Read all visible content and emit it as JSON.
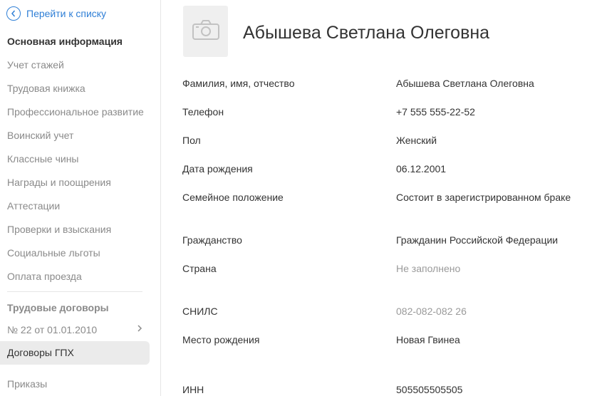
{
  "sidebar": {
    "back_label": "Перейти к списку",
    "items": [
      {
        "label": "Основная информация"
      },
      {
        "label": "Учет стажей"
      },
      {
        "label": "Трудовая книжка"
      },
      {
        "label": "Профессиональное развитие"
      },
      {
        "label": "Воинский учет"
      },
      {
        "label": "Классные чины"
      },
      {
        "label": "Награды и поощрения"
      },
      {
        "label": "Аттестации"
      },
      {
        "label": "Проверки и взыскания"
      },
      {
        "label": "Социальные льготы"
      },
      {
        "label": "Оплата проезда"
      }
    ],
    "contracts_title": "Трудовые договоры",
    "contract_item": "№ 22 от 01.01.2010",
    "gph_label": "Договоры ГПХ",
    "orders_label": "Приказы"
  },
  "profile": {
    "full_name": "Абышева Светлана Олеговна",
    "fields": [
      {
        "label": "Фамилия, имя, отчество",
        "value": "Абышева Светлана Олеговна"
      },
      {
        "label": "Телефон",
        "value": "+7 555 555-22-52"
      },
      {
        "label": "Пол",
        "value": "Женский"
      },
      {
        "label": "Дата рождения",
        "value": "06.12.2001"
      },
      {
        "label": "Семейное положение",
        "value": "Состоит в зарегистрированном браке"
      },
      {
        "label": "Гражданство",
        "value": "Гражданин Российской Федерации"
      },
      {
        "label": "Страна",
        "value": "Не заполнено"
      },
      {
        "label": "СНИЛС",
        "value": "082-082-082 26"
      },
      {
        "label": "Место рождения",
        "value": "Новая Гвинеа"
      },
      {
        "label": "ИНН",
        "value": "505505505505"
      }
    ]
  },
  "colors": {
    "accent": "#2f7fd6",
    "muted": "#9a9a9a",
    "active_bg": "#ebebeb"
  }
}
